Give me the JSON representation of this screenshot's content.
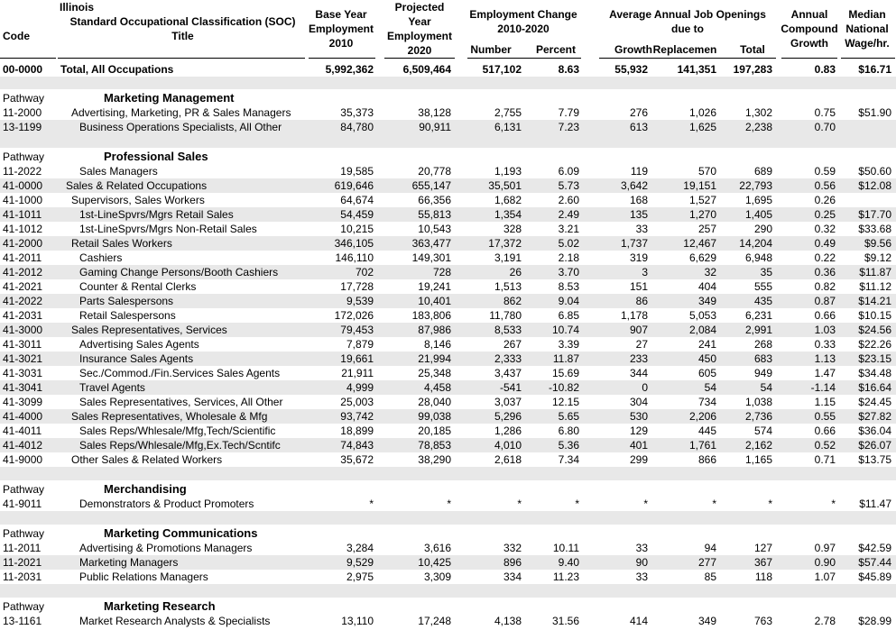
{
  "headers": {
    "code": [
      "Code"
    ],
    "title": [
      "Illinois",
      "Standard Occupational Classification (SOC)",
      "Title"
    ],
    "base": [
      "Base Year",
      "Employment",
      "2010"
    ],
    "proj": [
      "Projected",
      "Year",
      "Employment",
      "2020"
    ],
    "change": [
      "Employment Change",
      "2010-2020"
    ],
    "change_number": "Number",
    "change_percent": "Percent",
    "openings": [
      "Average Annual Job Openings",
      "due to"
    ],
    "growth": "Growth",
    "replacement": "Replacemen",
    "total": "Total",
    "compound": [
      "Annual",
      "Compound",
      "Growth"
    ],
    "median": [
      "Median",
      "National",
      "Wage/hr."
    ]
  },
  "total_row": [
    "00-0000",
    "Total, All Occupations",
    "5,992,362",
    "6,509,464",
    "517,102",
    "8.63",
    "55,932",
    "141,351",
    "197,283",
    "0.83",
    "$16.71"
  ],
  "sections": [
    {
      "pathway": "Pathway",
      "name": "Marketing Management",
      "rows": [
        [
          "11-2000",
          "Advertising, Marketing, PR & Sales Managers",
          "35,373",
          "38,128",
          "2,755",
          "7.79",
          "276",
          "1,026",
          "1,302",
          "0.75",
          "$51.90"
        ],
        [
          "13-1199",
          "Business Operations Specialists, All Other",
          "84,780",
          "90,911",
          "6,131",
          "7.23",
          "613",
          "1,625",
          "2,238",
          "0.70",
          ""
        ]
      ]
    },
    {
      "pathway": "Pathway",
      "name": "Professional Sales",
      "rows": [
        [
          "11-2022",
          "Sales Managers",
          "19,585",
          "20,778",
          "1,193",
          "6.09",
          "119",
          "570",
          "689",
          "0.59",
          "$50.60"
        ],
        [
          "41-0000",
          "Sales & Related Occupations",
          "619,646",
          "655,147",
          "35,501",
          "5.73",
          "3,642",
          "19,151",
          "22,793",
          "0.56",
          "$12.08"
        ],
        [
          "41-1000",
          "Supervisors, Sales Workers",
          "64,674",
          "66,356",
          "1,682",
          "2.60",
          "168",
          "1,527",
          "1,695",
          "0.26",
          ""
        ],
        [
          "41-1011",
          "1st-LineSpvrs/Mgrs Retail Sales",
          "54,459",
          "55,813",
          "1,354",
          "2.49",
          "135",
          "1,270",
          "1,405",
          "0.25",
          "$17.70"
        ],
        [
          "41-1012",
          "1st-LineSpvrs/Mgrs Non-Retail Sales",
          "10,215",
          "10,543",
          "328",
          "3.21",
          "33",
          "257",
          "290",
          "0.32",
          "$33.68"
        ],
        [
          "41-2000",
          "Retail Sales Workers",
          "346,105",
          "363,477",
          "17,372",
          "5.02",
          "1,737",
          "12,467",
          "14,204",
          "0.49",
          "$9.56"
        ],
        [
          "41-2011",
          "Cashiers",
          "146,110",
          "149,301",
          "3,191",
          "2.18",
          "319",
          "6,629",
          "6,948",
          "0.22",
          "$9.12"
        ],
        [
          "41-2012",
          "Gaming Change Persons/Booth Cashiers",
          "702",
          "728",
          "26",
          "3.70",
          "3",
          "32",
          "35",
          "0.36",
          "$11.87"
        ],
        [
          "41-2021",
          "Counter & Rental Clerks",
          "17,728",
          "19,241",
          "1,513",
          "8.53",
          "151",
          "404",
          "555",
          "0.82",
          "$11.12"
        ],
        [
          "41-2022",
          "Parts Salespersons",
          "9,539",
          "10,401",
          "862",
          "9.04",
          "86",
          "349",
          "435",
          "0.87",
          "$14.21"
        ],
        [
          "41-2031",
          "Retail Salespersons",
          "172,026",
          "183,806",
          "11,780",
          "6.85",
          "1,178",
          "5,053",
          "6,231",
          "0.66",
          "$10.15"
        ],
        [
          "41-3000",
          "Sales Representatives, Services",
          "79,453",
          "87,986",
          "8,533",
          "10.74",
          "907",
          "2,084",
          "2,991",
          "1.03",
          "$24.56"
        ],
        [
          "41-3011",
          "Advertising Sales Agents",
          "7,879",
          "8,146",
          "267",
          "3.39",
          "27",
          "241",
          "268",
          "0.33",
          "$22.26"
        ],
        [
          "41-3021",
          "Insurance Sales Agents",
          "19,661",
          "21,994",
          "2,333",
          "11.87",
          "233",
          "450",
          "683",
          "1.13",
          "$23.15"
        ],
        [
          "41-3031",
          "Sec./Commod./Fin.Services Sales Agents",
          "21,911",
          "25,348",
          "3,437",
          "15.69",
          "344",
          "605",
          "949",
          "1.47",
          "$34.48"
        ],
        [
          "41-3041",
          "Travel Agents",
          "4,999",
          "4,458",
          "-541",
          "-10.82",
          "0",
          "54",
          "54",
          "-1.14",
          "$16.64"
        ],
        [
          "41-3099",
          "Sales Representatives, Services, All Other",
          "25,003",
          "28,040",
          "3,037",
          "12.15",
          "304",
          "734",
          "1,038",
          "1.15",
          "$24.45"
        ],
        [
          "41-4000",
          "Sales Representatives, Wholesale & Mfg",
          "93,742",
          "99,038",
          "5,296",
          "5.65",
          "530",
          "2,206",
          "2,736",
          "0.55",
          "$27.82"
        ],
        [
          "41-4011",
          "Sales Reps/Whlesale/Mfg,Tech/Scientific",
          "18,899",
          "20,185",
          "1,286",
          "6.80",
          "129",
          "445",
          "574",
          "0.66",
          "$36.04"
        ],
        [
          "41-4012",
          "Sales Reps/Whlesale/Mfg,Ex.Tech/Scntifc",
          "74,843",
          "78,853",
          "4,010",
          "5.36",
          "401",
          "1,761",
          "2,162",
          "0.52",
          "$26.07"
        ],
        [
          "41-9000",
          "Other Sales & Related Workers",
          "35,672",
          "38,290",
          "2,618",
          "7.34",
          "299",
          "866",
          "1,165",
          "0.71",
          "$13.75"
        ]
      ]
    },
    {
      "pathway": "Pathway",
      "name": "Merchandising",
      "rows": [
        [
          "41-9011",
          "Demonstrators & Product Promoters",
          "*",
          "*",
          "*",
          "*",
          "*",
          "*",
          "*",
          "*",
          "$11.47"
        ]
      ]
    },
    {
      "pathway": "Pathway",
      "name": "Marketing Communications",
      "rows": [
        [
          "11-2011",
          "Advertising & Promotions Managers",
          "3,284",
          "3,616",
          "332",
          "10.11",
          "33",
          "94",
          "127",
          "0.97",
          "$42.59"
        ],
        [
          "11-2021",
          "Marketing Managers",
          "9,529",
          "10,425",
          "896",
          "9.40",
          "90",
          "277",
          "367",
          "0.90",
          "$57.44"
        ],
        [
          "11-2031",
          "Public Relations Managers",
          "2,975",
          "3,309",
          "334",
          "11.23",
          "33",
          "85",
          "118",
          "1.07",
          "$45.89"
        ]
      ]
    },
    {
      "pathway": "Pathway",
      "name": "Marketing Research",
      "rows": [
        [
          "13-1161",
          "Market Research Analysts & Specialists",
          "13,110",
          "17,248",
          "4,138",
          "31.56",
          "414",
          "349",
          "763",
          "2.78",
          "$28.99"
        ]
      ]
    }
  ]
}
